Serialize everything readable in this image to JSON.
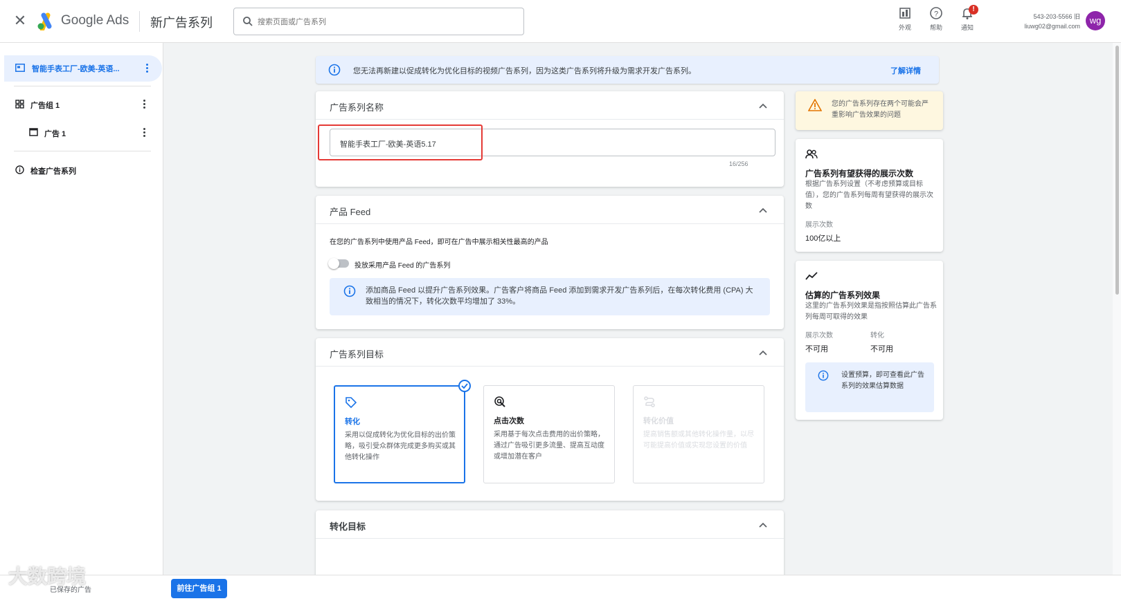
{
  "topbar": {
    "brand": "Google Ads",
    "page_title": "新广告系列",
    "search_placeholder": "搜索页面或广告系列",
    "appearance_label": "外观",
    "help_label": "帮助",
    "notifications_label": "通知",
    "notification_count": "!",
    "account_id": "543-203-5566 旧",
    "account_email": "liuwg02@gmail.com",
    "avatar_initials": "wg"
  },
  "sidebar": {
    "campaign_label": "智能手表工厂-欧美-英语...",
    "ad_group_label": "广告组 1",
    "ad_label": "广告 1",
    "review_label": "检查广告系列"
  },
  "banner": {
    "text": "您无法再新建以促成转化为优化目标的视频广告系列，因为这类广告系列将升级为需求开发广告系列。",
    "link": "了解详情"
  },
  "campaign_name": {
    "title": "广告系列名称",
    "value": "智能手表工厂-欧美-英语5.17",
    "counter": "16/256"
  },
  "product_feed": {
    "title": "产品 Feed",
    "description": "在您的广告系列中使用产品 Feed，即可在广告中展示相关性最高的产品",
    "toggle_label": "投放采用产品 Feed 的广告系列",
    "toggle_on": false,
    "info_text": "添加商品 Feed 以提升广告系列效果。广告客户将商品 Feed 添加到需求开发广告系列后，在每次转化费用 (CPA) 大致相当的情况下，转化次数平均增加了 33%。"
  },
  "campaign_goal": {
    "title": "广告系列目标",
    "options": [
      {
        "title": "转化",
        "description": "采用以促成转化为优化目标的出价策略，吸引受众群体完成更多购买或其他转化操作",
        "state": "selected"
      },
      {
        "title": "点击次数",
        "description": "采用基于每次点击费用的出价策略，通过广告吸引更多流量、提高互动度或增加潜在客户",
        "state": "default"
      },
      {
        "title": "转化价值",
        "description": "提高销售额或其他转化操作量，以尽可能提高价值或实现您设置的价值",
        "state": "disabled"
      }
    ]
  },
  "conversion_goal": {
    "title": "转化目标"
  },
  "right_panel": {
    "warning_text": "您的广告系列存在两个可能会严重影响广告效果的问题",
    "reach": {
      "title": "广告系列有望获得的展示次数",
      "description": "根据广告系列设置（不考虑预算或目标值），您的广告系列每周有望获得的展示次数",
      "metric_label": "展示次数",
      "metric_value": "100亿以上"
    },
    "estimate": {
      "title": "估算的广告系列效果",
      "description": "这里的广告系列效果是指按照估算此广告系列每周可取得的效果",
      "impressions_label": "展示次数",
      "impressions_value": "不可用",
      "conversions_label": "转化",
      "conversions_value": "不可用",
      "info_text": "设置预算，即可查看此广告系列的效果估算数据"
    }
  },
  "footer": {
    "next_button": "前往广告组 1",
    "watermark": "大数跨境",
    "footer_link": "已保存的广告"
  },
  "colors": {
    "accent": "#1a73e8",
    "warning_bg": "#fef7e0",
    "info_bg": "#e8f0fe",
    "alert": "#d93025",
    "avatar": "#8e24aa"
  }
}
